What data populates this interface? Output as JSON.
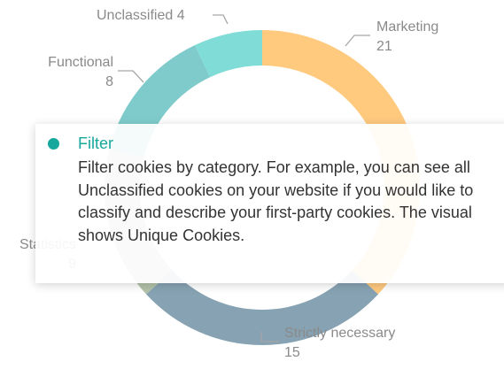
{
  "chart_data": {
    "type": "pie",
    "variant": "donut",
    "categories": [
      "Marketing",
      "Strictly necessary",
      "Statistics",
      "Functional",
      "Unclassified"
    ],
    "values": [
      21,
      15,
      9,
      8,
      4
    ],
    "colors": [
      "#ffc97e",
      "#87a3b3",
      "#b3c2ab",
      "#7fcbcb",
      "#7fdcd6"
    ],
    "legend": "none"
  },
  "tooltip": {
    "title": "Filter",
    "body": "Filter cookies by category. For example, you can see all Unclassified cookies on your website if you would like to classify and describe your first-party cookies. The visual shows Unique Cookies.",
    "dot_color": "#16a89c"
  }
}
